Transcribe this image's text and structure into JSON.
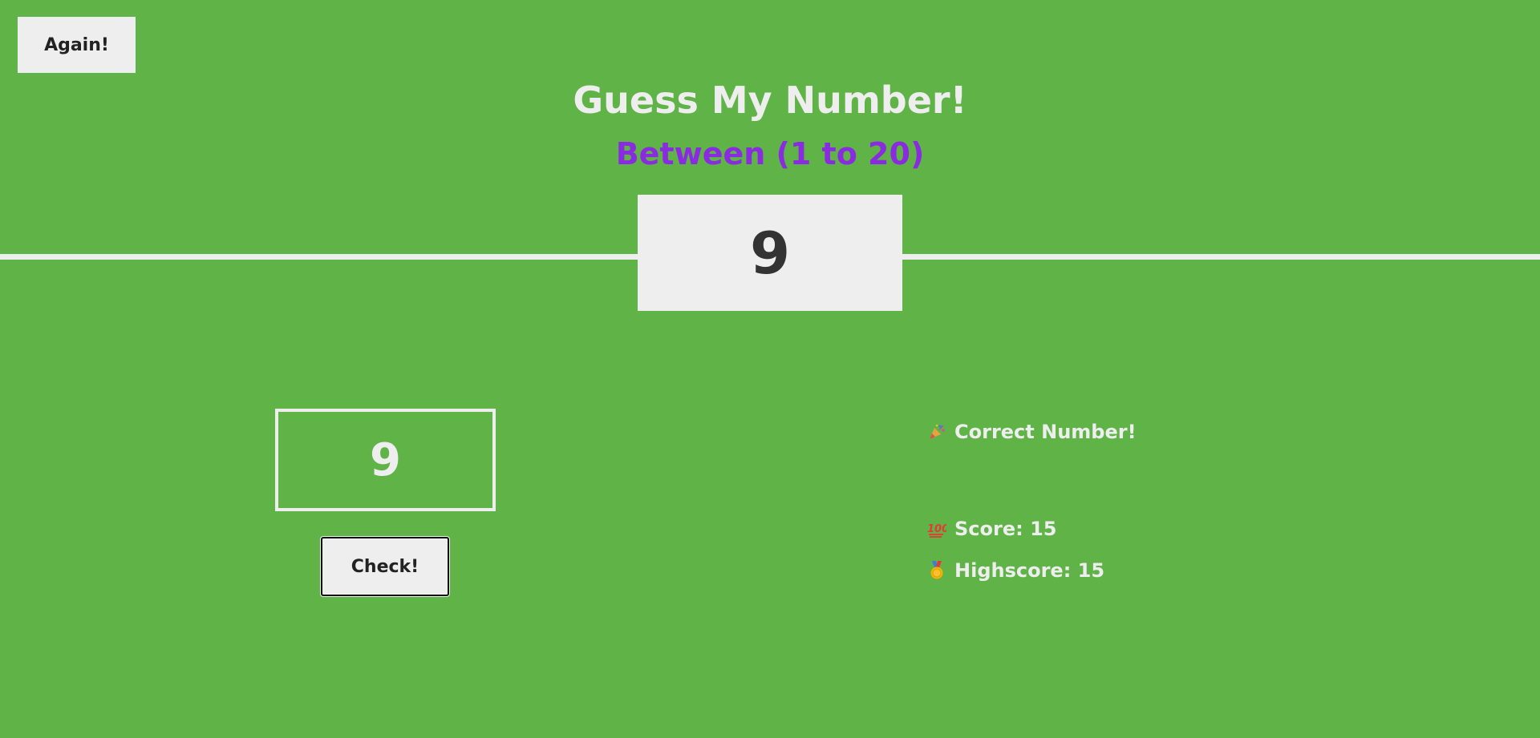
{
  "header": {
    "again_label": "Again!",
    "title": "Guess My Number!",
    "subtitle": "Between (1 to 20)"
  },
  "secret_number": "9",
  "guess": {
    "value": "9"
  },
  "check_label": "Check!",
  "status": {
    "message": "Correct Number!",
    "message_icon": "party-popper-icon",
    "score_text": "Score: 15",
    "score_icon": "hundred-points-icon",
    "highscore_text": "Highscore: 15",
    "highscore_icon": "medal-icon"
  },
  "colors": {
    "background": "#60b347",
    "subtitle": "#8a2be2",
    "light": "#eeeeee",
    "dark_text": "#333333"
  }
}
